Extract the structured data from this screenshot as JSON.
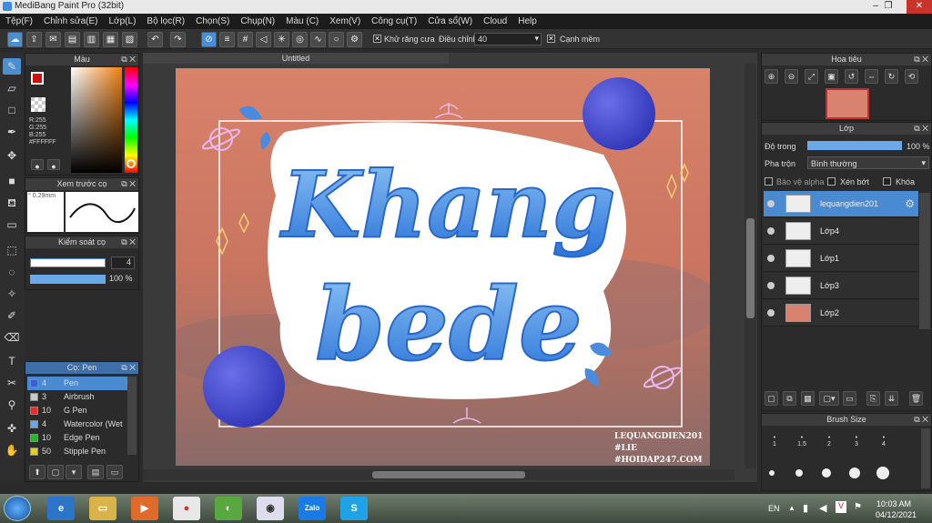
{
  "window": {
    "title": "MediBang Paint Pro (32bit)",
    "minimize": "–",
    "restore": "❐",
    "close": "✕"
  },
  "menu": [
    "Tệp(F)",
    "Chỉnh sửa(E)",
    "Lớp(L)",
    "Bộ lọc(R)",
    "Chọn(S)",
    "Chụp(N)",
    "Màu (C)",
    "Xem(V)",
    "Công cụ(T)",
    "Cửa sổ(W)",
    "Cloud",
    "Help"
  ],
  "toolbar": {
    "antialias_label": "Khử răng cưa",
    "antialias_checked": "✕",
    "correction_label": "Điều chỉnh",
    "correction_value": "40",
    "edge_label": "Cạnh mềm",
    "edge_checked": "✕"
  },
  "color_panel": {
    "title": "Màu",
    "rgb": [
      "R:255",
      "G:255",
      "B:255"
    ],
    "hex": "#FFFFFF",
    "primary": "#d01010",
    "secondary": "#ffffff"
  },
  "preview_panel": {
    "title": "Xem trước cọ",
    "size": "0.29mm"
  },
  "brush_control": {
    "title": "Kiểm soát cọ",
    "size": "4",
    "opacity": "100 %"
  },
  "brush_panel": {
    "title": "Cọ: Pen",
    "items": [
      {
        "size": "4",
        "name": "Pen",
        "color": "#3a5fd0"
      },
      {
        "size": "3",
        "name": "Airbrush",
        "color": "#c8c8c8"
      },
      {
        "size": "10",
        "name": "G Pen",
        "color": "#e03030"
      },
      {
        "size": "4",
        "name": "Watercolor (Wet",
        "color": "#6aa8e8"
      },
      {
        "size": "10",
        "name": "Edge Pen",
        "color": "#30b030"
      },
      {
        "size": "50",
        "name": "Stipple Pen",
        "color": "#e0d020"
      }
    ]
  },
  "canvas": {
    "tab": "Untitled",
    "art_line1": "Khang",
    "art_line2": "bede",
    "credit": [
      "LEQUANGDIEN201",
      "#LIE",
      "#HOIDAP247.COM"
    ]
  },
  "navigator": {
    "title": "Hoa tiêu"
  },
  "layers": {
    "title": "Lớp",
    "opacity_label": "Độ trong",
    "opacity_value": "100 %",
    "blend_label": "Pha trộn",
    "blend_value": "Bình thường",
    "protect_alpha": "Bảo vệ alpha",
    "clipping": "Xén bớt",
    "lock": "Khóa",
    "items": [
      "lequangdien201",
      "Lớp4",
      "Lớp1",
      "Lớp3",
      "Lớp2"
    ]
  },
  "brush_size": {
    "title": "Brush Size",
    "labels": [
      "1",
      "1.5",
      "2",
      "3",
      "4"
    ]
  },
  "taskbar": {
    "lang": "EN",
    "time": "10:03 AM",
    "date": "04/12/2021",
    "zalo": "Zalo",
    "skype": "S"
  }
}
